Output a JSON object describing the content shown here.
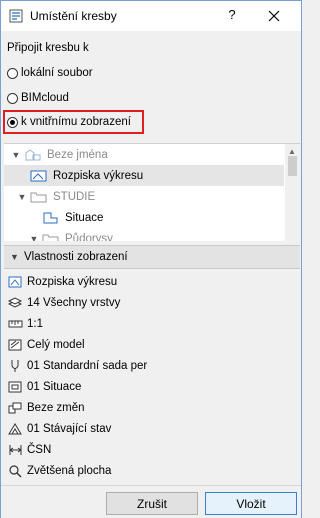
{
  "window": {
    "title": "Umístění kresby",
    "help": "?"
  },
  "link_section": {
    "label": "Připojit kresbu k"
  },
  "radios": [
    {
      "label": "lokální soubor",
      "checked": false
    },
    {
      "label": "BIMcloud",
      "checked": false
    },
    {
      "label": "k vnitřnímu zobrazení",
      "checked": true
    }
  ],
  "tree": {
    "items": [
      {
        "label": "Beze jména",
        "icon": "view-folder-icon",
        "level": 0,
        "expanded": true,
        "muted": true
      },
      {
        "label": "Rozpiska výkresu",
        "icon": "layout-view-icon",
        "level": 1,
        "selected": true
      },
      {
        "label": "STUDIE",
        "icon": "folder-icon",
        "level": 1,
        "expanded": true,
        "muted": true
      },
      {
        "label": "Situace",
        "icon": "plan-view-icon",
        "level": 2
      },
      {
        "label": "Půdorysy",
        "icon": "folder-icon",
        "level": 2,
        "expanded": true,
        "muted": true
      }
    ]
  },
  "properties": {
    "header": "Vlastnosti zobrazení",
    "items": [
      {
        "label": "Rozpiska výkresu",
        "icon": "view-name-icon"
      },
      {
        "label": "14 Všechny vrstvy",
        "icon": "layers-icon"
      },
      {
        "label": "1:1",
        "icon": "scale-icon"
      },
      {
        "label": "Celý model",
        "icon": "model-view-icon"
      },
      {
        "label": "01 Standardní sada per",
        "icon": "pen-set-icon"
      },
      {
        "label": "01 Situace",
        "icon": "model-view-options-icon"
      },
      {
        "label": "Beze změn",
        "icon": "renovation-filter-icon"
      },
      {
        "label": "01 Stávající stav",
        "icon": "graphic-override-icon"
      },
      {
        "label": "ČSN",
        "icon": "dimension-icon"
      },
      {
        "label": "Zvětšená plocha",
        "icon": "zoom-icon"
      }
    ]
  },
  "buttons": {
    "cancel": "Zrušit",
    "place": "Vložit"
  },
  "colors": {
    "highlight": "#e02020",
    "primary_border": "#3c7fd6",
    "accent_icon": "#2b6cc4"
  }
}
